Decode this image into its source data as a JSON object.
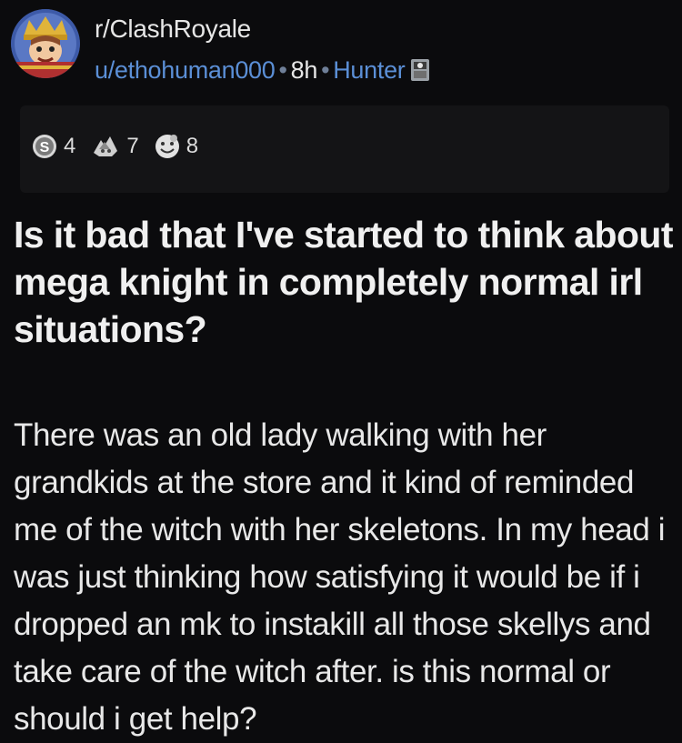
{
  "post": {
    "subreddit": "r/ClashRoyale",
    "author": "u/ethohuman000",
    "age": "8h",
    "flair": "Hunter",
    "separator": "•",
    "title": "Is it bad that I've started to think about mega knight in completely normal irl situations?",
    "body": "There was an old lady walking with her grandkids at the store and it kind of reminded me of the witch with her skeletons. In my head i was just thinking how satisfying it would be if i dropped an mk to instakill all those skellys and take care of the witch after. is this normal or should i get help?"
  },
  "awards": [
    {
      "icon": "silver-award-icon",
      "count": "4"
    },
    {
      "icon": "helpful-award-icon",
      "count": "7"
    },
    {
      "icon": "wholesome-award-icon",
      "count": "8"
    }
  ],
  "colors": {
    "background": "#0b0b0d",
    "awards_bar": "#141416",
    "meta_blue": "#5b8fd6",
    "text": "#ededed"
  }
}
